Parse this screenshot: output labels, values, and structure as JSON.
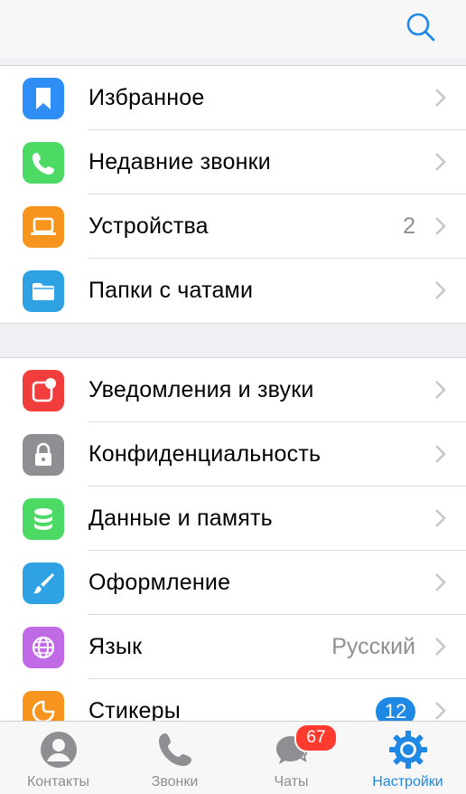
{
  "header": {},
  "section1": {
    "items": [
      {
        "label": "Избранное",
        "icon": "bookmark-icon",
        "color": "#2f8ef6"
      },
      {
        "label": "Недавние звонки",
        "icon": "phone-icon",
        "color": "#4cd964"
      },
      {
        "label": "Устройства",
        "value": "2",
        "icon": "laptop-icon",
        "color": "#f7941d"
      },
      {
        "label": "Папки с чатами",
        "icon": "folder-icon",
        "color": "#2fa2e3"
      }
    ]
  },
  "section2": {
    "items": [
      {
        "label": "Уведомления и звуки",
        "icon": "notification-icon",
        "color": "#f23d3d"
      },
      {
        "label": "Конфиденциальность",
        "icon": "lock-icon",
        "color": "#8e8e93"
      },
      {
        "label": "Данные и память",
        "icon": "database-icon",
        "color": "#4cd964"
      },
      {
        "label": "Оформление",
        "icon": "brush-icon",
        "color": "#2fa2e3"
      },
      {
        "label": "Язык",
        "value": "Русский",
        "icon": "globe-icon",
        "color": "#c06ae6"
      },
      {
        "label": "Стикеры",
        "badge": "12",
        "icon": "sticker-icon",
        "color": "#f7941d"
      }
    ]
  },
  "tabbar": {
    "tabs": [
      {
        "label": "Контакты",
        "icon": "person-icon"
      },
      {
        "label": "Звонки",
        "icon": "phone-icon"
      },
      {
        "label": "Чаты",
        "icon": "chat-icon",
        "badge": "67"
      },
      {
        "label": "Настройки",
        "icon": "gear-icon",
        "active": true
      }
    ]
  },
  "colors": {
    "accent": "#1e88e5",
    "badge_red": "#ff3b30"
  }
}
